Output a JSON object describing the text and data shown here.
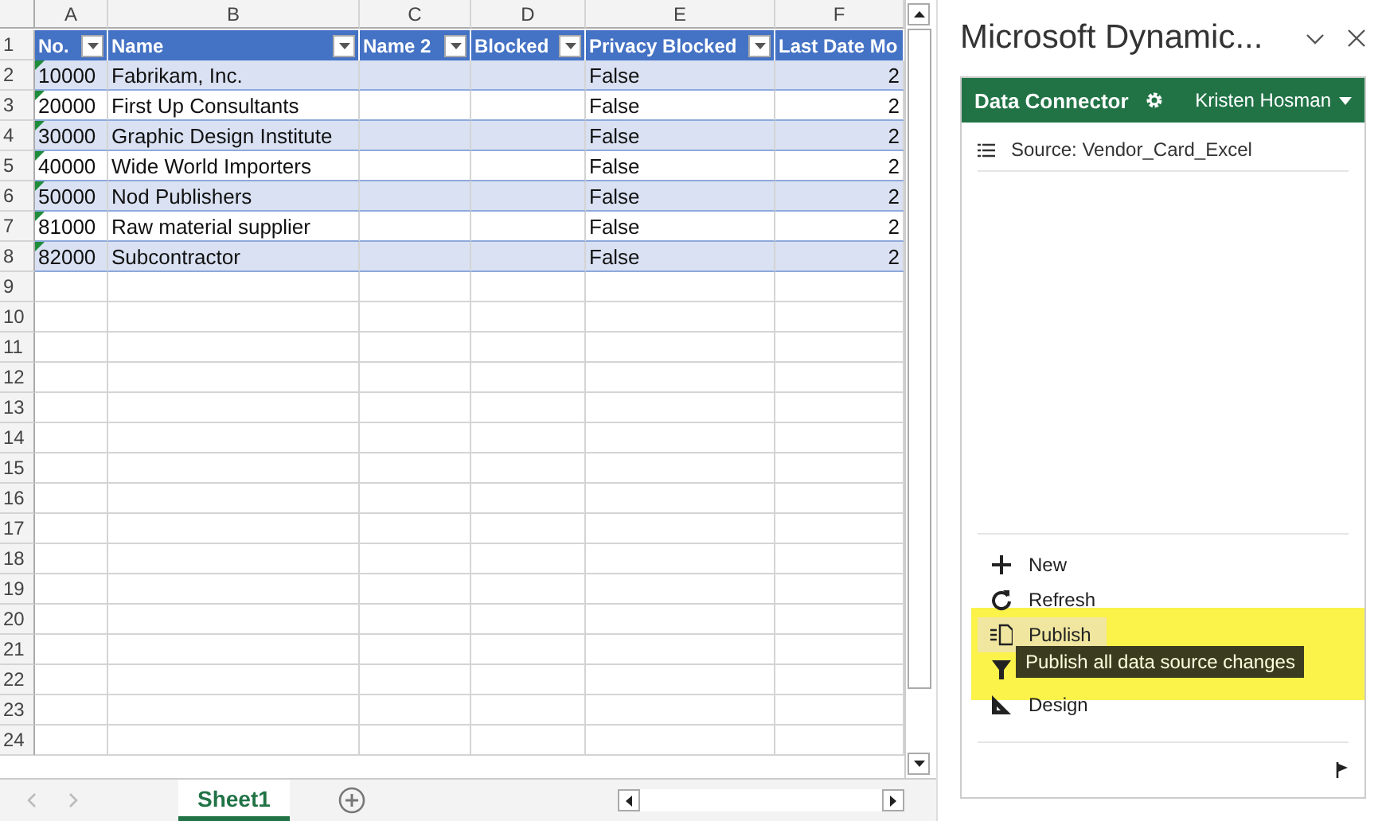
{
  "sheet": {
    "column_letters": [
      "A",
      "B",
      "C",
      "D",
      "E",
      "F"
    ],
    "table_headers": [
      "No.",
      "Name",
      "Name 2",
      "Blocked",
      "Privacy Blocked",
      "Last Date Mo"
    ],
    "row_numbers": [
      "1",
      "2",
      "3",
      "4",
      "5",
      "6",
      "7",
      "8",
      "9",
      "10",
      "11",
      "12",
      "13",
      "14",
      "15",
      "16",
      "17",
      "18",
      "19",
      "20",
      "21",
      "22",
      "23",
      "24"
    ],
    "rows": [
      {
        "cells": [
          "10000",
          "Fabrikam, Inc.",
          "",
          "",
          "False",
          "2"
        ],
        "number_as_text": true
      },
      {
        "cells": [
          "20000",
          "First Up Consultants",
          "",
          "",
          "False",
          "2"
        ],
        "number_as_text": true
      },
      {
        "cells": [
          "30000",
          "Graphic Design Institute",
          "",
          "",
          "False",
          "2"
        ],
        "number_as_text": true
      },
      {
        "cells": [
          "40000",
          "Wide World Importers",
          "",
          "",
          "False",
          "2"
        ],
        "number_as_text": true
      },
      {
        "cells": [
          "50000",
          "Nod Publishers",
          "",
          "",
          "False",
          "2"
        ],
        "number_as_text": true
      },
      {
        "cells": [
          "81000",
          "Raw material supplier",
          "",
          "",
          "False",
          "2"
        ],
        "number_as_text": true
      },
      {
        "cells": [
          "82000",
          "Subcontractor",
          "",
          "",
          "False",
          "2"
        ],
        "number_as_text": true
      }
    ],
    "sheet_tabs": [
      {
        "label": "Sheet1",
        "selected": true
      }
    ]
  },
  "panel": {
    "title": "Microsoft Dynamic...",
    "header": {
      "title": "Data Connector",
      "user": "Kristen Hosman"
    },
    "source": "Source: Vendor_Card_Excel",
    "actions": [
      {
        "label": "New",
        "hovered": false
      },
      {
        "label": "Refresh",
        "hovered": false
      },
      {
        "label": "Publish",
        "hovered": true
      },
      {
        "hovered": false
      },
      {
        "label": "Design",
        "hovered": false
      }
    ],
    "tooltip": "Publish all data source changes"
  }
}
